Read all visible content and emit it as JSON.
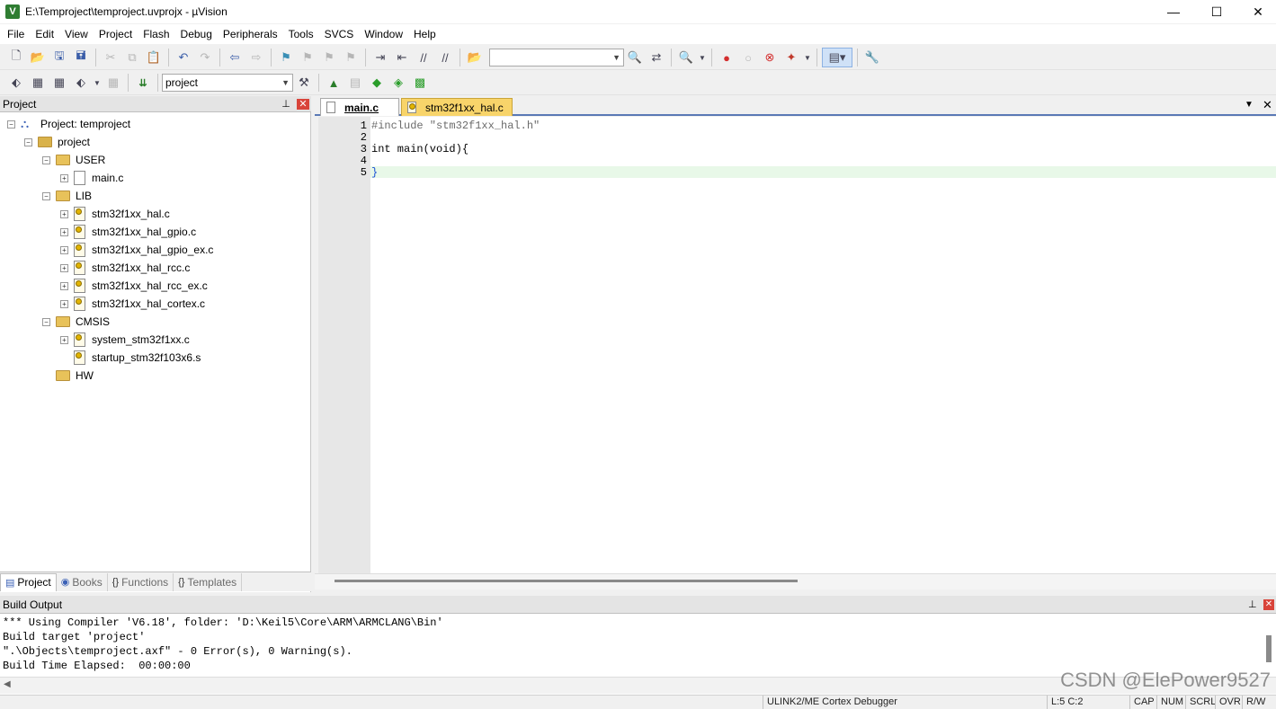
{
  "window": {
    "title": "E:\\Temproject\\temproject.uvprojx - µVision",
    "app_icon": "V",
    "controls": {
      "minimize": "—",
      "maximize": "☐",
      "close": "✕"
    }
  },
  "menu": [
    "File",
    "Edit",
    "View",
    "Project",
    "Flash",
    "Debug",
    "Peripherals",
    "Tools",
    "SVCS",
    "Window",
    "Help"
  ],
  "toolbar2": {
    "target_select": "project"
  },
  "project_panel": {
    "title": "Project",
    "tree": {
      "root": "Project: temproject",
      "target": "project",
      "groups": [
        {
          "name": "USER",
          "files": [
            "main.c"
          ]
        },
        {
          "name": "LIB",
          "files": [
            "stm32f1xx_hal.c",
            "stm32f1xx_hal_gpio.c",
            "stm32f1xx_hal_gpio_ex.c",
            "stm32f1xx_hal_rcc.c",
            "stm32f1xx_hal_rcc_ex.c",
            "stm32f1xx_hal_cortex.c"
          ]
        },
        {
          "name": "CMSIS",
          "files": [
            "system_stm32f1xx.c",
            "startup_stm32f103x6.s"
          ]
        },
        {
          "name": "HW",
          "files": []
        }
      ]
    },
    "tabs": [
      "Project",
      "Books",
      "Functions",
      "Templates"
    ]
  },
  "editor": {
    "tabs": [
      "main.c",
      "stm32f1xx_hal.c"
    ],
    "active_tab": "main.c",
    "lines": [
      {
        "n": "1",
        "text": "#include \"stm32f1xx_hal.h\""
      },
      {
        "n": "2",
        "text": ""
      },
      {
        "n": "3",
        "text": "int main(void){"
      },
      {
        "n": "4",
        "text": ""
      },
      {
        "n": "5",
        "text": "}"
      }
    ]
  },
  "build_output": {
    "title": "Build Output",
    "lines": [
      "*** Using Compiler 'V6.18', folder: 'D:\\Keil5\\Core\\ARM\\ARMCLANG\\Bin'",
      "Build target 'project'",
      "\".\\Objects\\temproject.axf\" - 0 Error(s), 0 Warning(s).",
      "Build Time Elapsed:  00:00:00"
    ]
  },
  "status_bar": {
    "debugger": "ULINK2/ME Cortex Debugger",
    "position": "L:5 C:2",
    "indicators": [
      "CAP",
      "NUM",
      "SCRL",
      "OVR",
      "R/W"
    ]
  },
  "watermark": "CSDN @ElePower9527"
}
